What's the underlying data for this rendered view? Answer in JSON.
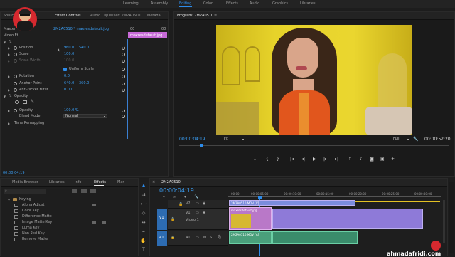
{
  "workspaces": [
    "Learning",
    "Assembly",
    "Editing",
    "Color",
    "Effects",
    "Audio",
    "Graphics",
    "Libraries"
  ],
  "active_workspace": "Editing",
  "source_panel": {
    "source_tab": "Source: 2M",
    "tabs": [
      "Effect Controls",
      "Audio Clip Mixer: 2M2A0510",
      "Metada"
    ],
    "active_tab": "Effect Controls",
    "master_label": "Master",
    "master_clip": "2M2A0510 * maxresdefault.jpg",
    "video_effects_label": "Video Ef",
    "mini_tc_start": "00",
    "mini_tc_end": "00",
    "mini_clip": "maxresdefault.jpg",
    "motion_icon": "fx",
    "position_label": "Position",
    "position_x": "960.0",
    "position_y": "540.0",
    "scale_label": "Scale",
    "scale_value": "100.0",
    "scale_width_label": "Scale Width",
    "scale_width_value": "100.0",
    "uniform_scale_label": "Uniform Scale",
    "rotation_label": "Rotation",
    "rotation_value": "0.0",
    "anchor_label": "Anchor Point",
    "anchor_x": "640.0",
    "anchor_y": "360.0",
    "antiflicker_label": "Anti-flicker Filter",
    "antiflicker_value": "0.00",
    "opacity_section_icon": "fx",
    "opacity_section": "Opacity",
    "opacity_label": "Opacity",
    "opacity_value": "100.0 %",
    "blend_label": "Blend Mode",
    "blend_value": "Normal",
    "time_remap_label": "Time Remapping",
    "timecode": "00:00:04:19"
  },
  "program_monitor": {
    "title": "Program: 2M2A0510",
    "timecode": "00:00:04:19",
    "fit": "Fit",
    "quality": "Full",
    "duration": "00:00:52:20"
  },
  "project_panel": {
    "tabs": [
      "Media Browser",
      "Libraries",
      "Info",
      "Effects",
      "Mar"
    ],
    "active_tab": "Effects",
    "folder": "Keying",
    "items": [
      "Alpha Adjust",
      "Color Key",
      "Difference Matte",
      "Image Matte Key",
      "Luma Key",
      "Non Red Key",
      "Remove Matte"
    ]
  },
  "timeline": {
    "tab": "2M2A0510",
    "timecode": "00:00:04:19",
    "ruler": [
      "00:00",
      "00:00:05:00",
      "00:00:10:00",
      "00:00:15:00",
      "00:00:20:00",
      "00:00:25:00",
      "00:00:30:00"
    ],
    "tracks": {
      "v2_label": "V2",
      "v1_label": "V1",
      "v1_name": "Video 1",
      "a1_label": "A1",
      "src_v": "V1",
      "src_a": "A1",
      "audio_m": "M",
      "audio_s": "S"
    },
    "clips": {
      "v2_clip": "maxresdefault.jpg",
      "v1_clip": "2M2A0510.MOV [V]",
      "a1_clip": "2M2A0510.MOV [A]",
      "top_clip": "2M2A0510.MOV [V]"
    }
  },
  "watermark": "ahmadafridi.com",
  "icons": {
    "program_controls": [
      "marker",
      "in-point",
      "out-point",
      "go-to-in",
      "step-back",
      "play",
      "step-forward",
      "go-to-out",
      "lift",
      "extract",
      "export-frame",
      "button-editor"
    ]
  }
}
